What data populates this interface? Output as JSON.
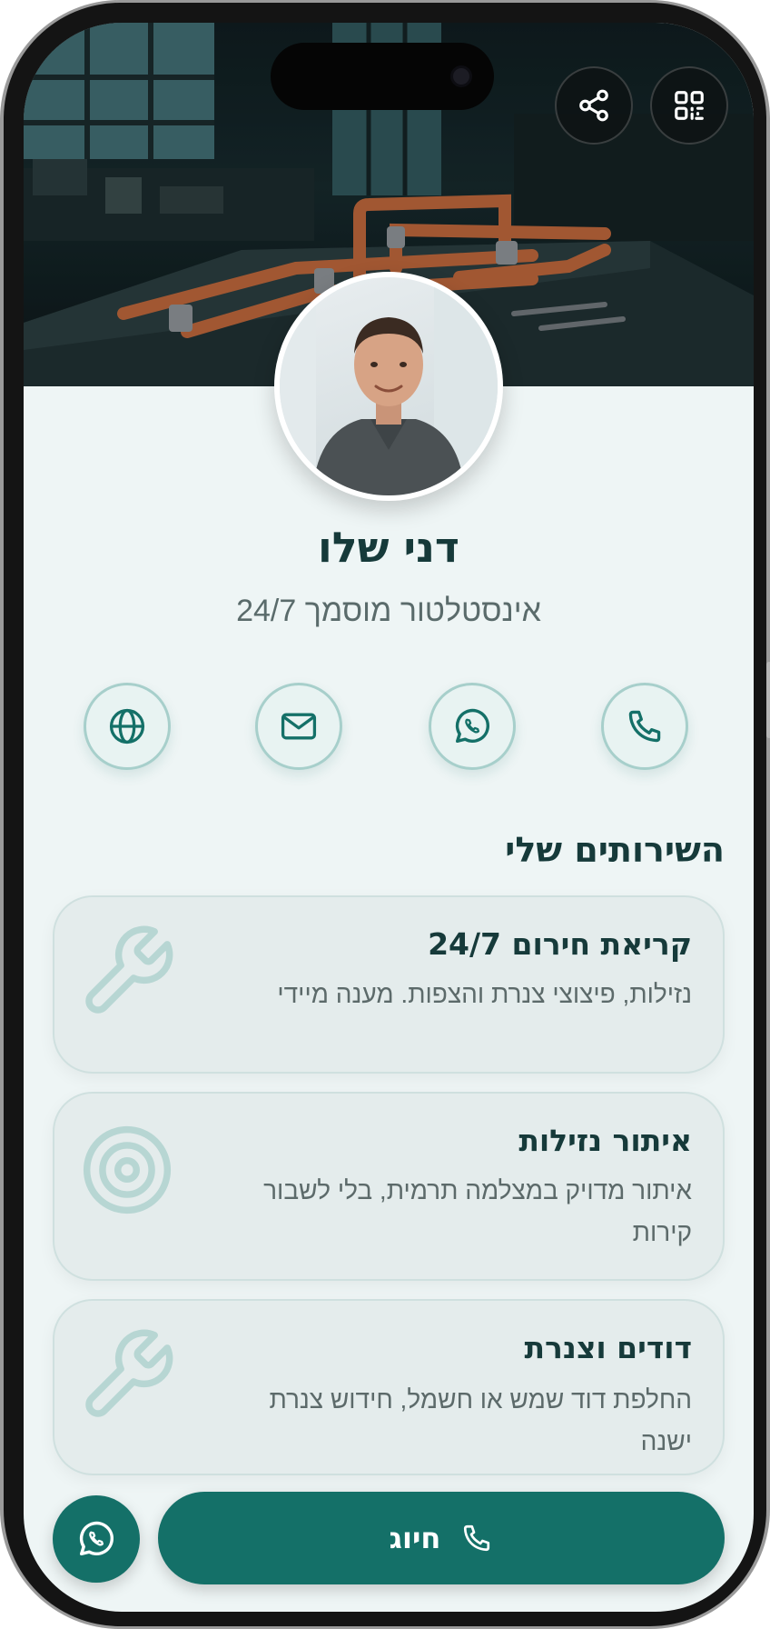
{
  "profile": {
    "name": "דני שלו",
    "title": "אינסטלטור מוסמך 24/7"
  },
  "top_actions": [
    {
      "icon": "share-icon"
    },
    {
      "icon": "qr-code-icon"
    }
  ],
  "contact_buttons": [
    {
      "icon": "globe-icon"
    },
    {
      "icon": "mail-icon"
    },
    {
      "icon": "whatsapp-icon"
    },
    {
      "icon": "phone-icon"
    }
  ],
  "services": {
    "heading": "השירותים שלי",
    "items": [
      {
        "title": "קריאת חירום 24/7",
        "description": "נזילות, פיצוצי צנרת והצפות. מענה מיידי",
        "icon": "wrench-icon"
      },
      {
        "title": "איתור נזילות",
        "description": "איתור מדויק במצלמה תרמית, בלי לשבור קירות",
        "icon": "target-icon"
      },
      {
        "title": "דודים וצנרת",
        "description": "החלפת דוד שמש או חשמל, חידוש צנרת ישנה",
        "icon": "wrench-icon"
      }
    ]
  },
  "bottom_bar": {
    "call_label": "חיוג",
    "whatsapp_icon": "whatsapp-icon"
  },
  "colors": {
    "brand": "#147068",
    "heading": "#163a3a",
    "background": "#eef5f5"
  }
}
